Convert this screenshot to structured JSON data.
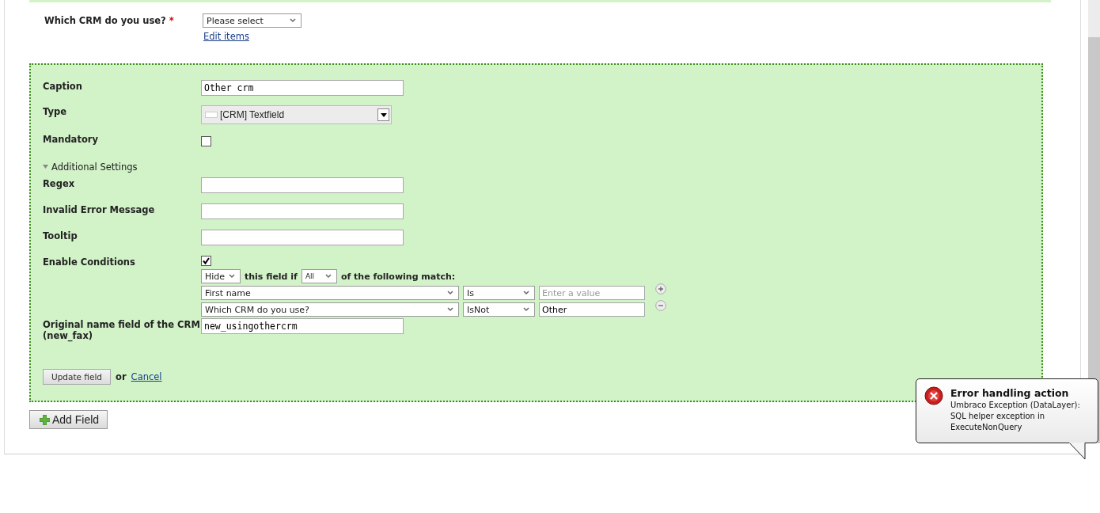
{
  "question": {
    "label": "Which CRM do you use?",
    "required_mark": "*",
    "select": "Please select",
    "link": "Edit items"
  },
  "panel": {
    "fields": [
      {
        "kind": "text",
        "label": "Caption",
        "value": "Other crm"
      },
      {
        "kind": "type",
        "label": "Type",
        "value": "[CRM] Textfield"
      },
      {
        "kind": "checkbox",
        "label": "Mandatory",
        "checked": false
      },
      {
        "kind": "toggle",
        "label": "Additional Settings",
        "expanded": true
      },
      {
        "kind": "text",
        "label": "Regex"
      },
      {
        "kind": "text",
        "label": "Invalid Error Message"
      },
      {
        "kind": "text",
        "label": "Tooltip"
      },
      {
        "kind": "conditions",
        "label": "Enable Conditions",
        "checked": true,
        "action": "Hide",
        "text_before": "this field if",
        "match": "All",
        "text_after": "of the following match:",
        "rules": [
          {
            "field": "First name",
            "operator": "Is",
            "placeholder": "Enter a value",
            "kind": "add"
          },
          {
            "field": "Which CRM do you use?",
            "operator": "IsNot",
            "value": "Other",
            "kind": "remove"
          }
        ]
      },
      {
        "kind": "text",
        "label": "Original name field of the CRM (new_fax)",
        "value": "new_usingothercrm"
      }
    ],
    "update_button": "Update field",
    "or_text": "or",
    "cancel_link": "Cancel"
  },
  "add_button": "Add Field",
  "notification": {
    "title": "Error handling action",
    "message": "Umbraco Exception (DataLayer): SQL helper exception in ExecuteNonQuery"
  }
}
